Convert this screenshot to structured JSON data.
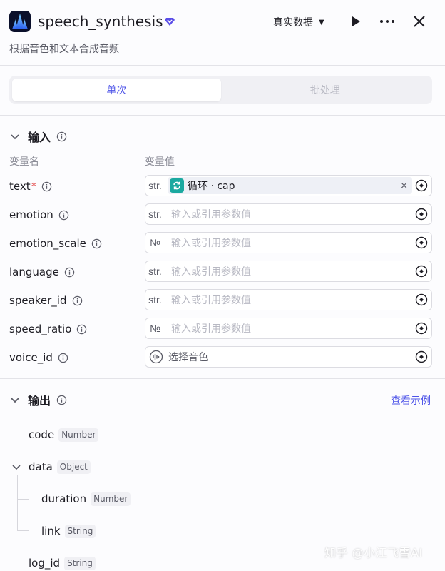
{
  "header": {
    "title": "speech_synthesis",
    "subtitle": "根据音色和文本合成音频",
    "env_label": "真实数据",
    "logo_icon": "waveform-logo-icon",
    "verified_icon": "diamond-badge-icon"
  },
  "tabs": [
    {
      "label": "单次",
      "active": true
    },
    {
      "label": "批处理",
      "active": false
    }
  ],
  "input": {
    "title": "输入",
    "col_name": "变量名",
    "col_value": "变量值",
    "params": [
      {
        "name": "text",
        "required_mark": "*",
        "type": "str.",
        "ref_label": "循环 · cap",
        "clear": "×"
      },
      {
        "name": "emotion",
        "type": "str.",
        "placeholder": "输入或引用参数值"
      },
      {
        "name": "emotion_scale",
        "type": "№",
        "placeholder": "输入或引用参数值"
      },
      {
        "name": "language",
        "type": "str.",
        "placeholder": "输入或引用参数值"
      },
      {
        "name": "speaker_id",
        "type": "str.",
        "placeholder": "输入或引用参数值"
      },
      {
        "name": "speed_ratio",
        "type": "№",
        "placeholder": "输入或引用参数值"
      },
      {
        "name": "voice_id",
        "type_icon": "voice-icon",
        "placeholder": "选择音色"
      }
    ]
  },
  "output": {
    "title": "输出",
    "example_link": "查看示例",
    "fields": [
      {
        "name": "code",
        "type": "Number"
      },
      {
        "name": "data",
        "type": "Object"
      },
      {
        "name": "duration",
        "type": "Number"
      },
      {
        "name": "link",
        "type": "String"
      },
      {
        "name": "log_id",
        "type": "String"
      }
    ]
  },
  "watermark": "知乎 @小江飞雪AI",
  "colors": {
    "accent": "#4d53e8",
    "loop_teal": "#1ba9a0",
    "required": "#e34c4c"
  }
}
